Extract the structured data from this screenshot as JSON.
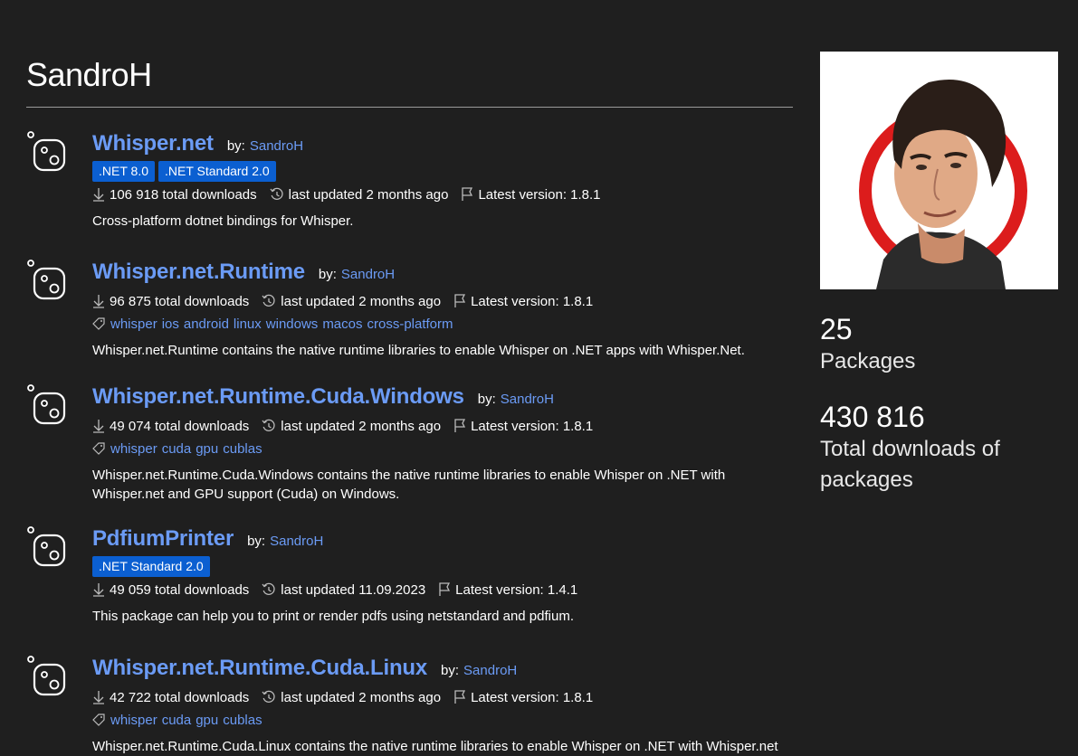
{
  "profile": {
    "name": "SandroH",
    "packages_count": "25",
    "packages_label": "Packages",
    "downloads_count": "430 816",
    "downloads_label": "Total downloads of packages"
  },
  "colors": {
    "background": "#1f1f1f",
    "link": "#6b9bf5",
    "badge": "#0b5fd1"
  },
  "icons": {
    "package": "package-icon",
    "download": "download-icon",
    "history": "history-icon",
    "flag": "flag-icon",
    "tag": "tag-icon"
  },
  "packages": [
    {
      "title": "Whisper.net",
      "by_label": "by:",
      "author": "SandroH",
      "frameworks": [
        ".NET 8.0",
        ".NET Standard 2.0"
      ],
      "downloads": "106 918 total downloads",
      "updated": "last updated 2 months ago",
      "version": "Latest version: 1.8.1",
      "tags": [],
      "description": "Cross-platform dotnet bindings for Whisper."
    },
    {
      "title": "Whisper.net.Runtime",
      "by_label": "by:",
      "author": "SandroH",
      "frameworks": [],
      "downloads": "96 875 total downloads",
      "updated": "last updated 2 months ago",
      "version": "Latest version: 1.8.1",
      "tags": [
        "whisper",
        "ios",
        "android",
        "linux",
        "windows",
        "macos",
        "cross-platform"
      ],
      "description": "Whisper.net.Runtime contains the native runtime libraries to enable Whisper on .NET apps with Whisper.Net."
    },
    {
      "title": "Whisper.net.Runtime.Cuda.Windows",
      "by_label": "by:",
      "author": "SandroH",
      "frameworks": [],
      "downloads": "49 074 total downloads",
      "updated": "last updated 2 months ago",
      "version": "Latest version: 1.8.1",
      "tags": [
        "whisper",
        "cuda",
        "gpu",
        "cublas"
      ],
      "description": "Whisper.net.Runtime.Cuda.Windows contains the native runtime libraries to enable Whisper on .NET with Whisper.net and GPU support (Cuda) on Windows."
    },
    {
      "title": "PdfiumPrinter",
      "by_label": "by:",
      "author": "SandroH",
      "frameworks": [
        ".NET Standard 2.0"
      ],
      "downloads": "49 059 total downloads",
      "updated": "last updated 11.09.2023",
      "version": "Latest version: 1.4.1",
      "tags": [],
      "description": "This package can help you to print or render pdfs using netstandard and pdfium."
    },
    {
      "title": "Whisper.net.Runtime.Cuda.Linux",
      "by_label": "by:",
      "author": "SandroH",
      "frameworks": [],
      "downloads": "42 722 total downloads",
      "updated": "last updated 2 months ago",
      "version": "Latest version: 1.8.1",
      "tags": [
        "whisper",
        "cuda",
        "gpu",
        "cublas"
      ],
      "description": "Whisper.net.Runtime.Cuda.Linux contains the native runtime libraries to enable Whisper on .NET with Whisper.net"
    }
  ]
}
